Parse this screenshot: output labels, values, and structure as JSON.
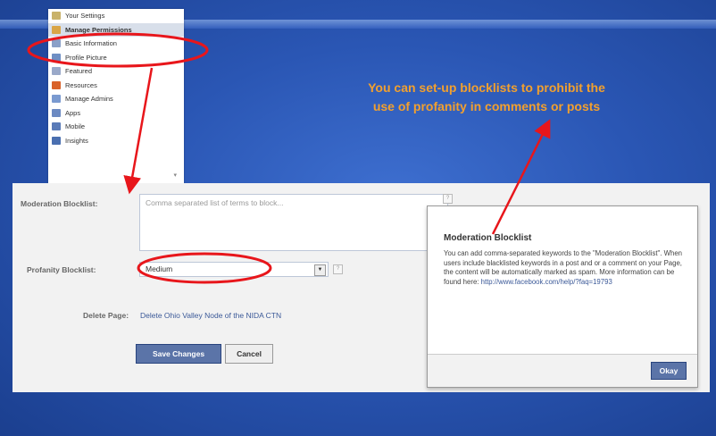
{
  "menu": {
    "items": [
      {
        "label": "Your Settings",
        "icon": "settings-icon",
        "color": "#c9b26a"
      },
      {
        "label": "Manage Permissions",
        "icon": "permissions-icon",
        "color": "#d9a547",
        "selected": true
      },
      {
        "label": "Basic Information",
        "icon": "info-icon",
        "color": "#8aa0c8"
      },
      {
        "label": "Profile Picture",
        "icon": "picture-icon",
        "color": "#6f8fc4"
      },
      {
        "label": "Featured",
        "icon": "featured-icon",
        "color": "#9aa9c9"
      },
      {
        "label": "Resources",
        "icon": "resources-icon",
        "color": "#d9622a"
      },
      {
        "label": "Manage Admins",
        "icon": "admins-icon",
        "color": "#7a9ad0"
      },
      {
        "label": "Apps",
        "icon": "apps-icon",
        "color": "#6c8ac2"
      },
      {
        "label": "Mobile",
        "icon": "mobile-icon",
        "color": "#5a7bb8"
      },
      {
        "label": "Insights",
        "icon": "insights-icon",
        "color": "#4a6fb0"
      }
    ]
  },
  "callout": {
    "line1": "You can set-up blocklists to prohibit the",
    "line2": "use of profanity in comments or posts"
  },
  "settings": {
    "moderation_label": "Moderation Blocklist:",
    "moderation_placeholder": "Comma separated list of terms to block...",
    "profanity_label": "Profanity Blocklist:",
    "profanity_value": "Medium",
    "delete_label": "Delete Page:",
    "delete_link": "Delete Ohio Valley Node of the NIDA CTN",
    "save_button": "Save Changes",
    "cancel_button": "Cancel"
  },
  "tooltip": {
    "title": "Moderation Blocklist",
    "body": "You can add comma-separated keywords to the \"Moderation Blocklist\". When users include blacklisted keywords in a post and or a comment on your Page, the content will be automatically marked as spam. More information can be found here:",
    "link": "http://www.facebook.com/help/?faq=19793",
    "okay_button": "Okay"
  },
  "colors": {
    "background": "#2a56b4",
    "callout_text": "#f2a02e",
    "annotation_red": "#e8161b",
    "facebook_blue": "#3b5998"
  }
}
